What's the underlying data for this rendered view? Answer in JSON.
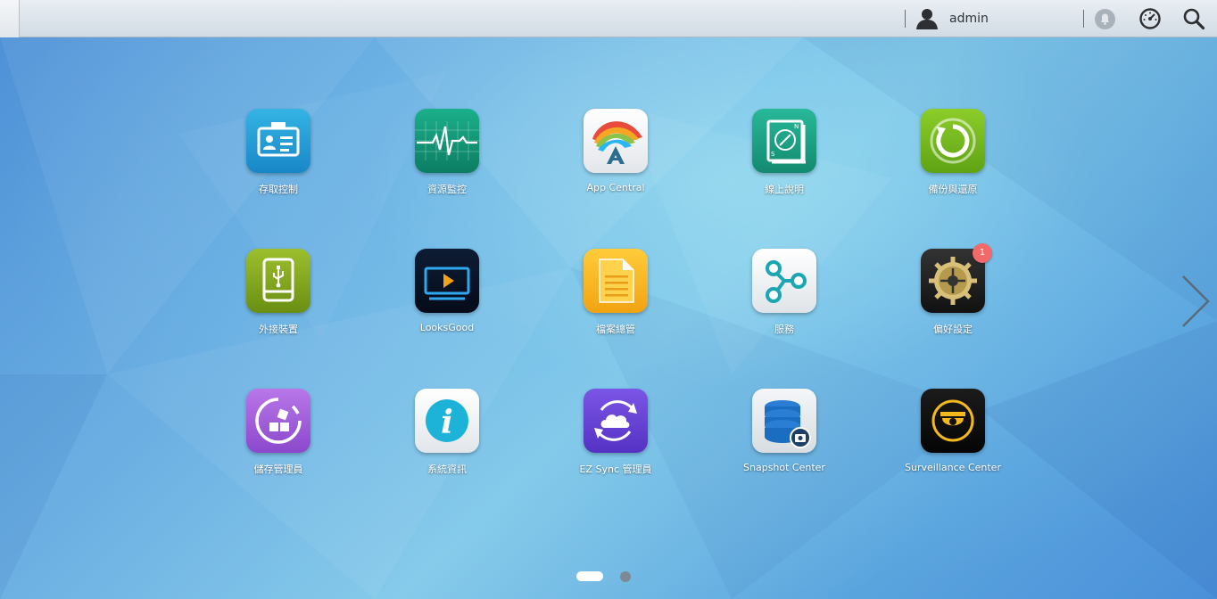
{
  "topbar": {
    "username": "admin"
  },
  "apps": [
    {
      "label": "存取控制",
      "icon": "access-control-icon"
    },
    {
      "label": "資源監控",
      "icon": "resource-monitor-icon"
    },
    {
      "label": "App Central",
      "icon": "app-central-icon"
    },
    {
      "label": "線上說明",
      "icon": "online-help-icon"
    },
    {
      "label": "備份與還原",
      "icon": "backup-restore-icon"
    },
    {
      "label": "外接裝置",
      "icon": "external-device-icon"
    },
    {
      "label": "LooksGood",
      "icon": "looksgood-icon"
    },
    {
      "label": "檔案總管",
      "icon": "file-explorer-icon"
    },
    {
      "label": "服務",
      "icon": "services-icon"
    },
    {
      "label": "偏好設定",
      "icon": "settings-gear-icon",
      "badge": "1"
    },
    {
      "label": "儲存管理員",
      "icon": "storage-manager-icon"
    },
    {
      "label": "系統資訊",
      "icon": "system-info-icon"
    },
    {
      "label": "EZ Sync 管理員",
      "icon": "ez-sync-icon"
    },
    {
      "label": "Snapshot Center",
      "icon": "snapshot-center-icon"
    },
    {
      "label": "Surveillance Center",
      "icon": "surveillance-camera-icon"
    }
  ],
  "pager": {
    "pages": 2,
    "current": 1
  },
  "colors": {
    "topbar": "#dfe5eb",
    "badge": "#f06a6a",
    "label_text": "#ffffff"
  }
}
